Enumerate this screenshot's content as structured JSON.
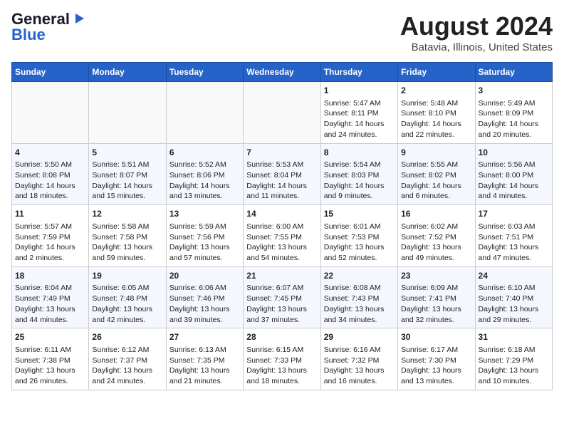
{
  "header": {
    "logo_line1": "General",
    "logo_line2": "Blue",
    "main_title": "August 2024",
    "subtitle": "Batavia, Illinois, United States"
  },
  "days_of_week": [
    "Sunday",
    "Monday",
    "Tuesday",
    "Wednesday",
    "Thursday",
    "Friday",
    "Saturday"
  ],
  "weeks": [
    [
      {
        "day": "",
        "content": ""
      },
      {
        "day": "",
        "content": ""
      },
      {
        "day": "",
        "content": ""
      },
      {
        "day": "",
        "content": ""
      },
      {
        "day": "1",
        "content": "Sunrise: 5:47 AM\nSunset: 8:11 PM\nDaylight: 14 hours and 24 minutes."
      },
      {
        "day": "2",
        "content": "Sunrise: 5:48 AM\nSunset: 8:10 PM\nDaylight: 14 hours and 22 minutes."
      },
      {
        "day": "3",
        "content": "Sunrise: 5:49 AM\nSunset: 8:09 PM\nDaylight: 14 hours and 20 minutes."
      }
    ],
    [
      {
        "day": "4",
        "content": "Sunrise: 5:50 AM\nSunset: 8:08 PM\nDaylight: 14 hours and 18 minutes."
      },
      {
        "day": "5",
        "content": "Sunrise: 5:51 AM\nSunset: 8:07 PM\nDaylight: 14 hours and 15 minutes."
      },
      {
        "day": "6",
        "content": "Sunrise: 5:52 AM\nSunset: 8:06 PM\nDaylight: 14 hours and 13 minutes."
      },
      {
        "day": "7",
        "content": "Sunrise: 5:53 AM\nSunset: 8:04 PM\nDaylight: 14 hours and 11 minutes."
      },
      {
        "day": "8",
        "content": "Sunrise: 5:54 AM\nSunset: 8:03 PM\nDaylight: 14 hours and 9 minutes."
      },
      {
        "day": "9",
        "content": "Sunrise: 5:55 AM\nSunset: 8:02 PM\nDaylight: 14 hours and 6 minutes."
      },
      {
        "day": "10",
        "content": "Sunrise: 5:56 AM\nSunset: 8:00 PM\nDaylight: 14 hours and 4 minutes."
      }
    ],
    [
      {
        "day": "11",
        "content": "Sunrise: 5:57 AM\nSunset: 7:59 PM\nDaylight: 14 hours and 2 minutes."
      },
      {
        "day": "12",
        "content": "Sunrise: 5:58 AM\nSunset: 7:58 PM\nDaylight: 13 hours and 59 minutes."
      },
      {
        "day": "13",
        "content": "Sunrise: 5:59 AM\nSunset: 7:56 PM\nDaylight: 13 hours and 57 minutes."
      },
      {
        "day": "14",
        "content": "Sunrise: 6:00 AM\nSunset: 7:55 PM\nDaylight: 13 hours and 54 minutes."
      },
      {
        "day": "15",
        "content": "Sunrise: 6:01 AM\nSunset: 7:53 PM\nDaylight: 13 hours and 52 minutes."
      },
      {
        "day": "16",
        "content": "Sunrise: 6:02 AM\nSunset: 7:52 PM\nDaylight: 13 hours and 49 minutes."
      },
      {
        "day": "17",
        "content": "Sunrise: 6:03 AM\nSunset: 7:51 PM\nDaylight: 13 hours and 47 minutes."
      }
    ],
    [
      {
        "day": "18",
        "content": "Sunrise: 6:04 AM\nSunset: 7:49 PM\nDaylight: 13 hours and 44 minutes."
      },
      {
        "day": "19",
        "content": "Sunrise: 6:05 AM\nSunset: 7:48 PM\nDaylight: 13 hours and 42 minutes."
      },
      {
        "day": "20",
        "content": "Sunrise: 6:06 AM\nSunset: 7:46 PM\nDaylight: 13 hours and 39 minutes."
      },
      {
        "day": "21",
        "content": "Sunrise: 6:07 AM\nSunset: 7:45 PM\nDaylight: 13 hours and 37 minutes."
      },
      {
        "day": "22",
        "content": "Sunrise: 6:08 AM\nSunset: 7:43 PM\nDaylight: 13 hours and 34 minutes."
      },
      {
        "day": "23",
        "content": "Sunrise: 6:09 AM\nSunset: 7:41 PM\nDaylight: 13 hours and 32 minutes."
      },
      {
        "day": "24",
        "content": "Sunrise: 6:10 AM\nSunset: 7:40 PM\nDaylight: 13 hours and 29 minutes."
      }
    ],
    [
      {
        "day": "25",
        "content": "Sunrise: 6:11 AM\nSunset: 7:38 PM\nDaylight: 13 hours and 26 minutes."
      },
      {
        "day": "26",
        "content": "Sunrise: 6:12 AM\nSunset: 7:37 PM\nDaylight: 13 hours and 24 minutes."
      },
      {
        "day": "27",
        "content": "Sunrise: 6:13 AM\nSunset: 7:35 PM\nDaylight: 13 hours and 21 minutes."
      },
      {
        "day": "28",
        "content": "Sunrise: 6:15 AM\nSunset: 7:33 PM\nDaylight: 13 hours and 18 minutes."
      },
      {
        "day": "29",
        "content": "Sunrise: 6:16 AM\nSunset: 7:32 PM\nDaylight: 13 hours and 16 minutes."
      },
      {
        "day": "30",
        "content": "Sunrise: 6:17 AM\nSunset: 7:30 PM\nDaylight: 13 hours and 13 minutes."
      },
      {
        "day": "31",
        "content": "Sunrise: 6:18 AM\nSunset: 7:29 PM\nDaylight: 13 hours and 10 minutes."
      }
    ]
  ]
}
